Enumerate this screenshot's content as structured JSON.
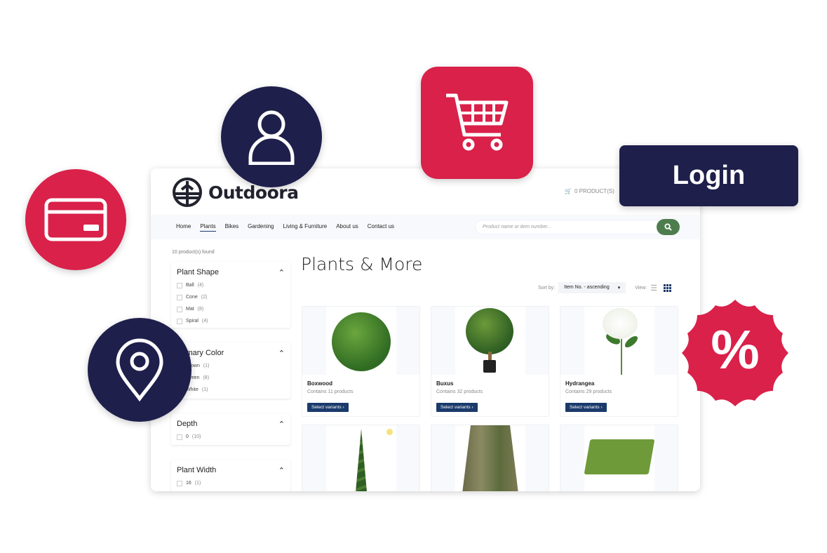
{
  "brand": {
    "name": "Outdoora"
  },
  "header": {
    "cart": "0 PRODUCT(S)"
  },
  "nav": {
    "items": [
      "Home",
      "Plants",
      "Bikes",
      "Gardening",
      "Living & Furniture",
      "About us",
      "Contact us"
    ],
    "active": "Plants"
  },
  "search": {
    "placeholder": "Product name or item number..."
  },
  "sidebar": {
    "found": "10 product(s) found",
    "facets": [
      {
        "title": "Plant Shape",
        "options": [
          {
            "label": "Ball",
            "count": "(4)"
          },
          {
            "label": "Cone",
            "count": "(2)"
          },
          {
            "label": "Mat",
            "count": "(8)"
          },
          {
            "label": "Spiral",
            "count": "(4)"
          }
        ]
      },
      {
        "title": "Primary Color",
        "options": [
          {
            "label": "Brown",
            "count": "(1)"
          },
          {
            "label": "Green",
            "count": "(8)"
          },
          {
            "label": "White",
            "count": "(1)"
          }
        ]
      },
      {
        "title": "Depth",
        "options": [
          {
            "label": "0",
            "count": "(10)"
          }
        ]
      },
      {
        "title": "Plant Width",
        "options": [
          {
            "label": "16",
            "count": "(1)"
          }
        ]
      }
    ]
  },
  "main": {
    "title": "Plants & More",
    "sort_label": "Sort by:",
    "sort_value": "Item No. - ascending",
    "view_label": "View:",
    "products": [
      {
        "name": "Boxwood",
        "count": "Contains 11 products",
        "button": "Select variants"
      },
      {
        "name": "Buxus",
        "count": "Contains 32 products",
        "button": "Select variants"
      },
      {
        "name": "Hydrangea",
        "count": "Contains 29 products",
        "button": "Select variants"
      }
    ]
  },
  "overlay": {
    "login": "Login",
    "percent": "%"
  },
  "colors": {
    "red": "#d9214a",
    "navy": "#1e1f4b",
    "green": "#4e7d4d",
    "button": "#1a3a6b"
  }
}
